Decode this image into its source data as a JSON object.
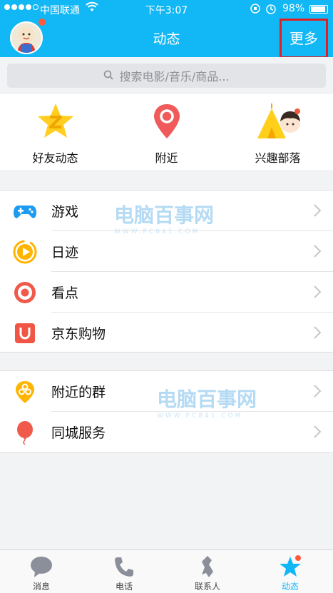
{
  "status": {
    "carrier": "中国联通",
    "time": "下午3:07",
    "battery": "98%"
  },
  "nav": {
    "title": "动态",
    "more_label": "更多"
  },
  "search": {
    "placeholder": "搜索电影/音乐/商品..."
  },
  "quick_items": [
    {
      "label": "好友动态",
      "icon": "qzone-star-icon"
    },
    {
      "label": "附近",
      "icon": "location-pin-icon"
    },
    {
      "label": "兴趣部落",
      "icon": "tribe-tent-icon"
    }
  ],
  "group1": [
    {
      "label": "游戏",
      "icon": "gamepad-icon"
    },
    {
      "label": "日迹",
      "icon": "play-circle-icon"
    },
    {
      "label": "看点",
      "icon": "eye-circle-icon"
    },
    {
      "label": "京东购物",
      "icon": "shopping-bag-icon"
    }
  ],
  "group2": [
    {
      "label": "附近的群",
      "icon": "nearby-group-icon"
    },
    {
      "label": "同城服务",
      "icon": "balloon-icon"
    }
  ],
  "watermark": {
    "title": "电脑百事网",
    "subtitle": "WWW.PC841.COM"
  },
  "tabs": [
    {
      "label": "消息",
      "icon": "chat-bubble-icon"
    },
    {
      "label": "电话",
      "icon": "phone-icon"
    },
    {
      "label": "联系人",
      "icon": "contacts-icon"
    },
    {
      "label": "动态",
      "icon": "star-feed-icon",
      "active": true
    }
  ],
  "colors": {
    "brand": "#12b7f5",
    "highlight": "#e02020"
  }
}
